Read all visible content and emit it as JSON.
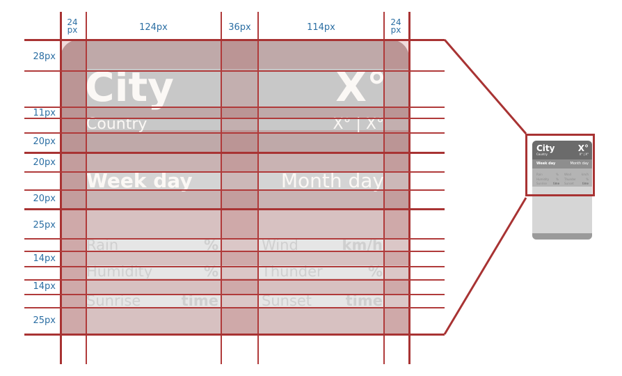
{
  "spec": {
    "column_labels": [
      "24 px",
      "124px",
      "36px",
      "114px",
      "24 px"
    ],
    "row_labels": [
      "28px",
      "11px",
      "20px",
      "20px",
      "20px",
      "25px",
      "14px",
      "14px",
      "25px"
    ],
    "header": {
      "city": "City",
      "temperature": "X°",
      "country": "Country",
      "min_max": "X° | X°"
    },
    "date": {
      "week_day": "Week day",
      "month_day": "Month day"
    },
    "info": [
      {
        "label": "Rain",
        "unit": "%"
      },
      {
        "label": "Wind",
        "unit": "km/h"
      },
      {
        "label": "Humidity",
        "unit": "%"
      },
      {
        "label": "Thunder",
        "unit": "%"
      },
      {
        "label": "Sunrise",
        "unit": "time"
      },
      {
        "label": "Sunset",
        "unit": "time"
      }
    ]
  },
  "preview": {
    "city": "City",
    "temperature": "X°",
    "country": "Country",
    "min_max": "X° | X°",
    "week_day": "Week day",
    "month_day": "Month day",
    "info": [
      {
        "label": "Rain",
        "unit": "%"
      },
      {
        "label": "Wind",
        "unit": "km/h"
      },
      {
        "label": "Humidity",
        "unit": "%"
      },
      {
        "label": "Thunder",
        "unit": "%"
      },
      {
        "label": "Sunrise",
        "unit": "time"
      },
      {
        "label": "Sunset",
        "unit": "time"
      }
    ]
  },
  "colors": {
    "guide_line": "#b03a3a",
    "measure_label": "#2b6ea3",
    "header_band": "#bfa9a9",
    "date_band": "#c9b3b3",
    "info_band": "#d7c1c1"
  }
}
